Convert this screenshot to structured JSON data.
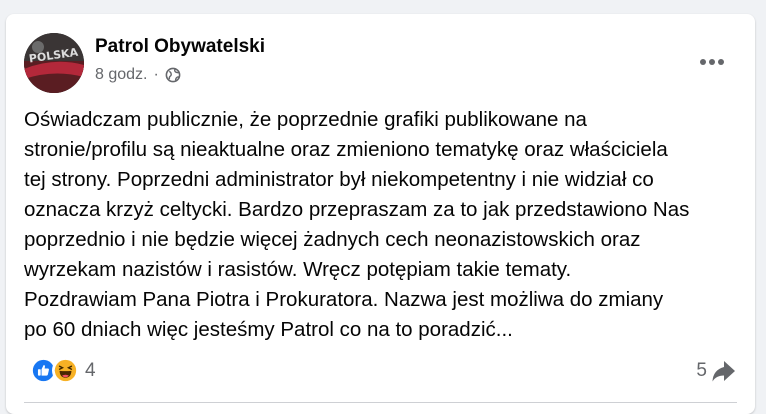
{
  "post": {
    "author": "Patrol Obywatelski",
    "time": "8 godz.",
    "separator": "·",
    "privacy_icon": "globe-icon",
    "more_icon": "more-horizontal-icon",
    "text": "Oświadczam publicznie, że poprzednie grafiki publikowane na\nstronie/profilu są nieaktualne oraz zmieniono tematykę oraz właściciela\ntej strony. Poprzedni administrator był niekompetentny i nie widział co\noznacza krzyż celtycki. Bardzo przepraszam za to jak przedstawiono Nas\npoprzednio i nie będzie więcej żadnych cech neonazistowskich oraz\nwyrzekam nazistów i rasistów. Wręcz potępiam takie tematy.\nPozdrawiam Pana Piotra i Prokuratora. Nazwa jest możliwa do zmiany\npo 60 dniach więc jesteśmy Patrol co na to poradzić...",
    "avatar_text": "POLSKA"
  },
  "engagement": {
    "reaction_icons": [
      "like-icon",
      "haha-icon"
    ],
    "reaction_count": "4",
    "share_count": "5",
    "share_icon": "share-arrow-icon"
  },
  "colors": {
    "like_blue": "#1877f2",
    "haha_yellow": "#f7b125",
    "secondary_text": "#65676b"
  }
}
